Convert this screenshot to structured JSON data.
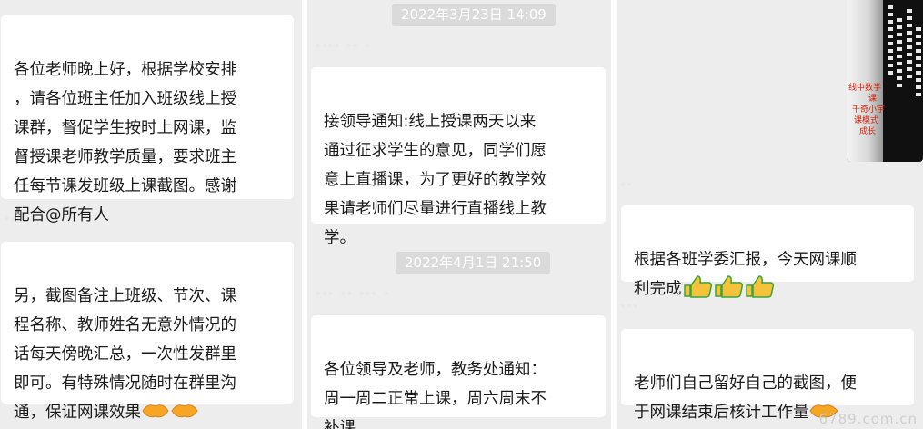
{
  "panel1": {
    "msg1": "各位老师晚上好，根据学校安排\n，请各位班主任加入班级线上授\n课群，督促学生按时上网课，监\n督授课老师教学质量，要求班主\n任每节课发班级上课截图。感谢\n配合@所有人",
    "sender": "··· ·",
    "msg2": "另，截图备注上班级、节次、课\n程名称、教师姓名无意外情况的\n话每天傍晚汇总，一次性发群里\n即可。有特殊情况随时在群里沟\n通，保证网课效果"
  },
  "panel2": {
    "timestamp1": "2022年3月23日 14:09",
    "sender1": "···· ·· ·",
    "msg1": "接领导通知:线上授课两天以来\n通过征求学生的意见，同学们愿\n意上直播课，为了更好的教学效\n果请老师们尽量进行直播线上教\n学。",
    "timestamp2": "2022年4月1日 21:50",
    "sender2": "··· ·· ··· ·",
    "msg2": "各位领导及老师，教务处通知：\n周一周二正常上课，周六周末不\n补课"
  },
  "panel3": {
    "sender1": "··",
    "msg1": "根据各班学委汇报，今天网课顺\n利完成",
    "sender2": "···",
    "msg2": "老师们自己留好自己的截图，便\n于网课结束后核计工作量",
    "screenshot_lines": [
      "线中数学",
      "课",
      "千奇小宇",
      "课模式",
      "成长"
    ]
  },
  "emoji": {
    "handshake": "handshake-icon",
    "thumbs_up": "thumbs-up-icon"
  },
  "watermark": "6789.com.cn"
}
